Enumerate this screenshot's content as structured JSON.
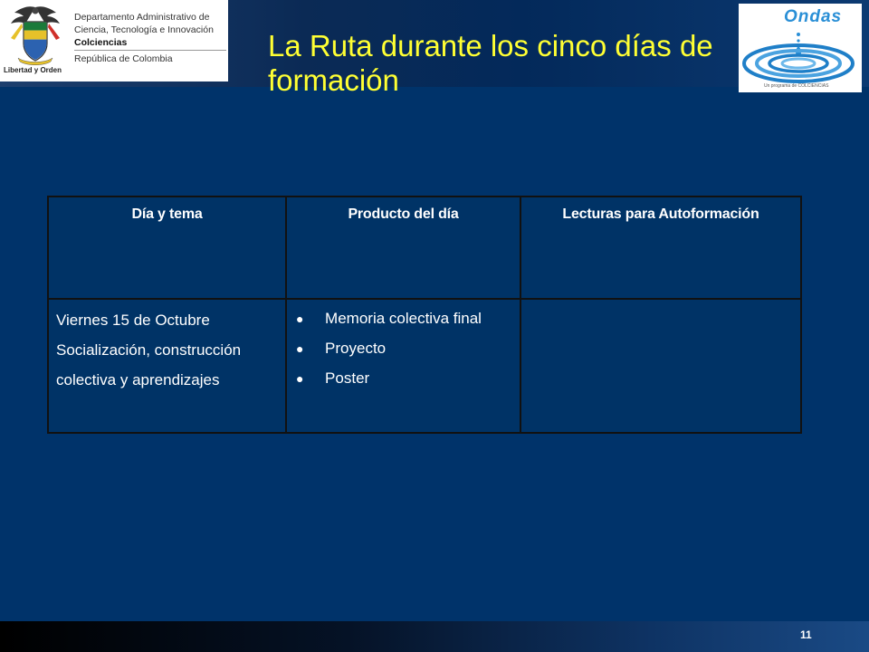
{
  "logo_left": {
    "seal_caption": "Libertad y Orden",
    "lines": [
      "Departamento Administrativo de",
      "Ciencia, Tecnología e Innovación"
    ],
    "org": "Colciencias",
    "country": "República de Colombia"
  },
  "logo_right": {
    "name": "Ondas",
    "tagline": "Un programa de COLCIENCIAS"
  },
  "title": "La Ruta durante los cinco días de formación",
  "table": {
    "headers": [
      "Día y tema",
      "Producto del día",
      "Lecturas para Autoformación"
    ],
    "row": {
      "day_lines": [
        "Viernes 15 de Octubre",
        "Socialización, construcción",
        "colectiva y aprendizajes"
      ],
      "products": [
        "Memoria colectiva final",
        "Proyecto",
        "Poster"
      ],
      "readings": ""
    }
  },
  "page_number": "11",
  "colors": {
    "background": "#003366",
    "title": "#ffff33",
    "ondas_blue": "#2a8fd6"
  }
}
